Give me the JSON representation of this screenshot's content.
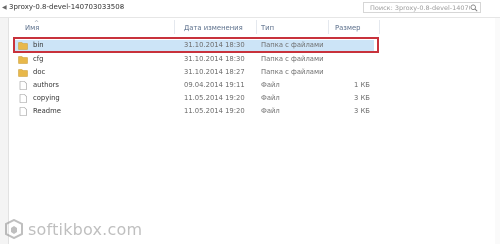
{
  "breadcrumb": {
    "path": "3proxy-0.8-devel-140703033508"
  },
  "search": {
    "placeholder": "Поиск: 3proxy-0.8-devel-14070"
  },
  "columns": {
    "name": "Имя",
    "date": "Дата изменения",
    "type": "Тип",
    "size": "Размер"
  },
  "files": [
    {
      "name": "bin",
      "date": "31.10.2014 18:30",
      "type": "Папка с файлами",
      "size": "",
      "icon": "folder-icon",
      "selected": true
    },
    {
      "name": "cfg",
      "date": "31.10.2014 18:30",
      "type": "Папка с файлами",
      "size": "",
      "icon": "folder-icon",
      "selected": false
    },
    {
      "name": "doc",
      "date": "31.10.2014 18:27",
      "type": "Папка с файлами",
      "size": "",
      "icon": "folder-icon",
      "selected": false
    },
    {
      "name": "authors",
      "date": "09.04.2014 19:11",
      "type": "Файл",
      "size": "1 КБ",
      "icon": "file-icon",
      "selected": false
    },
    {
      "name": "copying",
      "date": "11.05.2014 19:20",
      "type": "Файл",
      "size": "3 КБ",
      "icon": "file-icon",
      "selected": false
    },
    {
      "name": "Readme",
      "date": "11.05.2014 19:20",
      "type": "Файл",
      "size": "3 КБ",
      "icon": "file-icon",
      "selected": false
    }
  ],
  "watermark": {
    "text": "softikbox.com"
  },
  "colors": {
    "selection": "#cce4f7",
    "highlight_border": "#c8323c",
    "folder": "#e8b84a"
  }
}
